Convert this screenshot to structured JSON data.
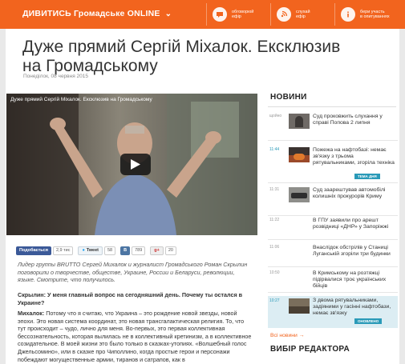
{
  "header": {
    "brand": "ДИВИТИСЬ Громадське ONLINE",
    "nav": [
      {
        "label_line1": "обговорюй",
        "label_line2": "ефір",
        "icon": "speech-bubble-icon"
      },
      {
        "label_line1": "слухай",
        "label_line2": "ефір",
        "icon": "radio-waves-icon"
      },
      {
        "label_line1": "бери участь",
        "label_line2": "в опитуваннях",
        "icon": "info-icon"
      }
    ]
  },
  "article": {
    "title": "Дуже прямий Сергій Міхалок. Ексклюзив на Громадському",
    "date": "Понеділок, 08 червня 2015",
    "video_title": "Дуже прямий Сергій Міхалок. Ексклюзив на Громадському",
    "lede": "Лидер группы BRUTTO Сергей Михалок и журналист Громадського Роман Скрылин поговорили о творчестве, обществе, Украине, России и Беларуси, революции, языке. Смотрите, что получилось.",
    "question": "Скрылин: У меня главный вопрос на сегодняшний день. Почему ты остался в Украине?",
    "answer_speaker": "Михалок:",
    "answer": " Потому что я считаю, что Украина – это рождение новой звезды, новой эпохи. Это новая система координат, это новая трансгалактическая религия. То, что тут происходит – чудо, лично для меня. Во-первых, это первая коллективная бессознательность, которая вылилась не в коллективный кретинизм, а в коллективное созидательное. В моей жизни это было только в сказках-утопиях. «Волшебный голос Джельсомино», или в сказке про Чиполлино, когда простые герои и персонажи побеждают могущественные армии, тиранов и сатрапов, как в"
  },
  "social": {
    "fb_label": "Подобається",
    "fb_count": "2,9 тис",
    "tw_label": "Tweet",
    "tw_count": "58",
    "vk_label": "В",
    "vk_count": "789",
    "gp_label": "g+",
    "gp_count": "20"
  },
  "sidebar": {
    "news_heading": "НОВИНИ",
    "items": [
      {
        "time": "щойно",
        "text": "Суд проковжить слухання у справі Попова 2 липня",
        "tag": ""
      },
      {
        "time": "11:44",
        "text": "Пожежа на нафтобазі: немає зв'язку з трьома рятувальниками, згоріла техніка",
        "tag": "ТЕМА ДНЯ"
      },
      {
        "time": "11:31",
        "text": "Суд заарештував автомобілі колишніх прокурорів Криму",
        "tag": ""
      },
      {
        "time": "11:22",
        "text": "В ГПУ заявили про арешт розвідниці «ДНР» у Запоріжжі",
        "tag": ""
      },
      {
        "time": "11:06",
        "text": "Внаслідок обстрілів у Станиці Луганській згоріли три будинки",
        "tag": ""
      },
      {
        "time": "10:50",
        "text": "В Кримському на розтяжці підірвалися троє українських бійців",
        "tag": ""
      },
      {
        "time": "10:27",
        "text": "З двома рятувальниками, задіяними у гасінні нафтобази, немає зв'язку",
        "tag": "ОНОВЛЕНО"
      }
    ],
    "all_news": "Всі новини →",
    "editor_heading": "ВИБІР РЕДАКТОРА"
  },
  "colors": {
    "accent": "#f2641e",
    "link_blue": "#2a9ab8"
  }
}
